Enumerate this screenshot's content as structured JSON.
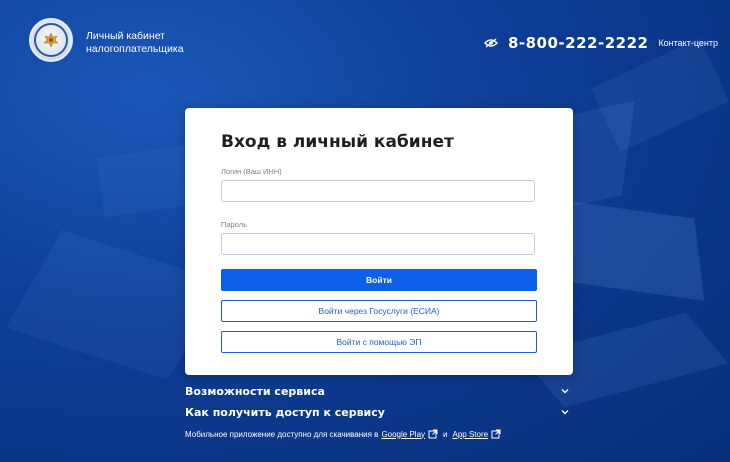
{
  "header": {
    "brand_line1": "Личный кабинет",
    "brand_line2": "налогоплательщика",
    "phone": "8-800-222-2222",
    "contact_label": "Контакт-центр"
  },
  "login": {
    "title": "Вход в личный кабинет",
    "login_label": "Логин (Ваш ИНН)",
    "login_value": "",
    "password_label": "Пароль",
    "password_value": "",
    "submit_label": "Войти",
    "gosuslugi_label": "Войти через Госуслуги (ЕСИА)",
    "ep_label": "Войти с помощью ЭП"
  },
  "info": {
    "features": "Возможности сервиса",
    "access": "Как получить доступ к сервису",
    "mobile_text": "Мобильное приложение доступно для скачивания в",
    "google_play": "Google Play",
    "and": "и",
    "app_store": "App Store"
  },
  "icons": {
    "logo": "fns-emblem-icon",
    "eye": "eye-crossed-icon",
    "chevron": "chevron-down-icon",
    "external": "external-link-icon"
  },
  "colors": {
    "background": "#0b3a8c",
    "primary_button": "#0d5fe8",
    "outline_button": "#1f5ed6",
    "card": "#ffffff"
  }
}
